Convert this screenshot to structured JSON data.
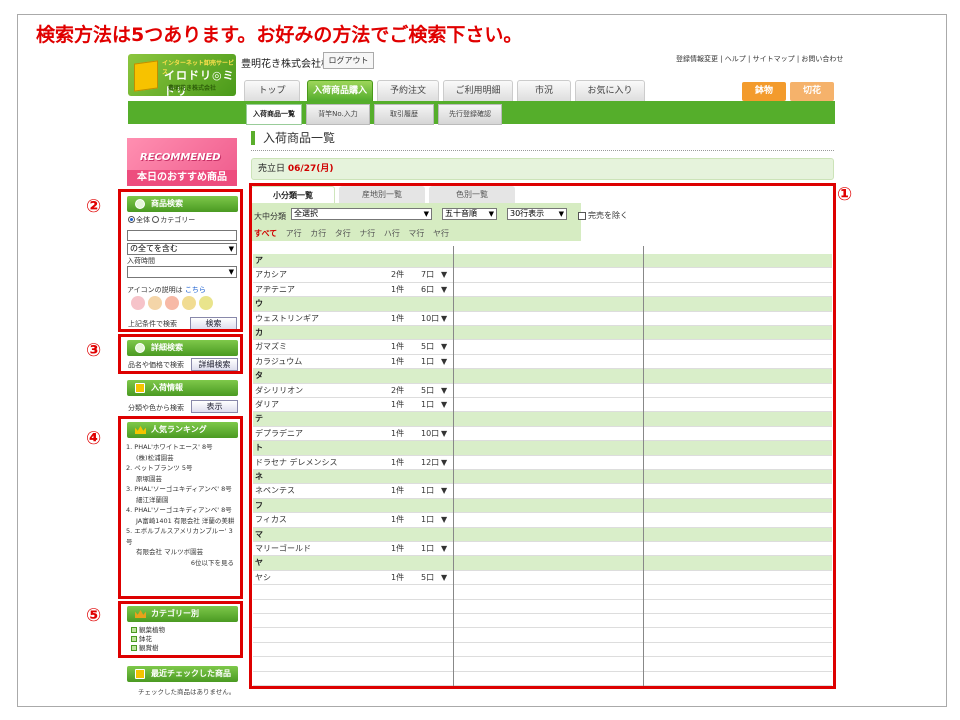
{
  "headline": "検索方法は5つあります。お好みの方法でご検索下さい。",
  "logo": {
    "top": "インターネット卸売サービス",
    "mid": "イロドリ◎ミドリ",
    "bot": "豊明花き株式会社"
  },
  "header": {
    "company": "豊明花き株式会社様",
    "logout": "ログアウト",
    "toplinks": "登録情報変更 | ヘルプ | サイトマップ | お問い合わせ"
  },
  "nav": {
    "tabs": [
      "トップ",
      "入荷商品購入",
      "予約注文",
      "ご利用明細",
      "市況",
      "お気に入り"
    ],
    "active": "入荷商品購入",
    "cat1": "鉢物",
    "cat2": "切花"
  },
  "subnav": [
    "入荷商品一覧",
    "背竿No.入力",
    "取引履歴",
    "先行登録確認"
  ],
  "colors": {
    "green": "#55ae2b",
    "red": "#dd0000",
    "pink": "#ef5b8c",
    "orange": "#f39b2c"
  },
  "recommend": {
    "title": "RECOMMENED",
    "subtitle": "本日のおすすめ商品"
  },
  "markers": [
    "①",
    "②",
    "③",
    "④",
    "⑤"
  ],
  "search": {
    "header": "商品検索",
    "radio_all": "全体",
    "radio_cat": "カテゴリー",
    "select_match": "の全てを含む",
    "arrival_label": "入荷時間",
    "icon_label": "アイコンの説明は",
    "icon_link": "こちら",
    "condition_label": "上記条件で検索",
    "button": "検索"
  },
  "detail": {
    "header": "詳細検索",
    "label": "品名や価格で検索",
    "button": "詳細検索"
  },
  "arrival": {
    "header": "入荷情報",
    "label": "分類や色から検索",
    "button": "表示"
  },
  "ranking": {
    "header": "人気ランキング",
    "items": [
      {
        "line1": "1. PHAL'ホワイトエース' 8号",
        "line2": "(株)松浦園芸"
      },
      {
        "line1": "2. ペットプランツ 5号",
        "line2": "原塚園芸"
      },
      {
        "line1": "3. PHAL'ソーゴユキディアンベ' 8号",
        "line2": "細江洋蘭園"
      },
      {
        "line1": "4. PHAL'ソーゴユキディアンベ' 8号",
        "line2": "JA富崎1401 有限会社 洋蘭の美耕"
      },
      {
        "line1": "5. エボルブルスアメリカンブルー' 3号",
        "line2": "有限会社 マルツボ園芸"
      }
    ],
    "more": "6位以下を見る"
  },
  "category": {
    "header": "カテゴリー別",
    "items": [
      "観葉植物",
      "鉢花",
      "観賞樹"
    ]
  },
  "recent": {
    "header": "最近チェックした商品",
    "empty": "チェックした商品はありません。"
  },
  "main": {
    "title": "入荷商品一覧",
    "date_label": "売立日",
    "date_value": "06/27(月)",
    "tabs": [
      "小分類一覧",
      "産地別一覧",
      "色別一覧"
    ],
    "filter_label": "大中分類",
    "filter_value": "全選択",
    "sort_value": "五十音順",
    "per_page": "30行表示",
    "exclude_label": "完売を除く",
    "kana": [
      "すべて",
      "ア行",
      "カ行",
      "タ行",
      "ナ行",
      "ハ行",
      "マ行",
      "ヤ行"
    ],
    "rows": [
      {
        "group": "ア"
      },
      {
        "name": "アカシア",
        "count": "2件",
        "qty": "7口"
      },
      {
        "name": "アヂテニア",
        "count": "1件",
        "qty": "6口"
      },
      {
        "group": "ウ"
      },
      {
        "name": "ウェストリンギア",
        "count": "1件",
        "qty": "10口"
      },
      {
        "group": "カ"
      },
      {
        "name": "ガマズミ",
        "count": "1件",
        "qty": "5口"
      },
      {
        "name": "カラジュウム",
        "count": "1件",
        "qty": "1口"
      },
      {
        "group": "タ"
      },
      {
        "name": "ダシリリオン",
        "count": "2件",
        "qty": "5口"
      },
      {
        "name": "ダリア",
        "count": "1件",
        "qty": "1口"
      },
      {
        "group": "テ"
      },
      {
        "name": "デプラデニア",
        "count": "1件",
        "qty": "10口"
      },
      {
        "group": "ト"
      },
      {
        "name": "ドラセナ デレメンシス",
        "count": "1件",
        "qty": "12口"
      },
      {
        "group": "ネ"
      },
      {
        "name": "ネペンテス",
        "count": "1件",
        "qty": "1口"
      },
      {
        "group": "フ"
      },
      {
        "name": "フィカス",
        "count": "1件",
        "qty": "1口"
      },
      {
        "group": "マ"
      },
      {
        "name": "マリーゴールド",
        "count": "1件",
        "qty": "1口"
      },
      {
        "group": "ヤ"
      },
      {
        "name": "ヤシ",
        "count": "1件",
        "qty": "5口"
      }
    ]
  }
}
